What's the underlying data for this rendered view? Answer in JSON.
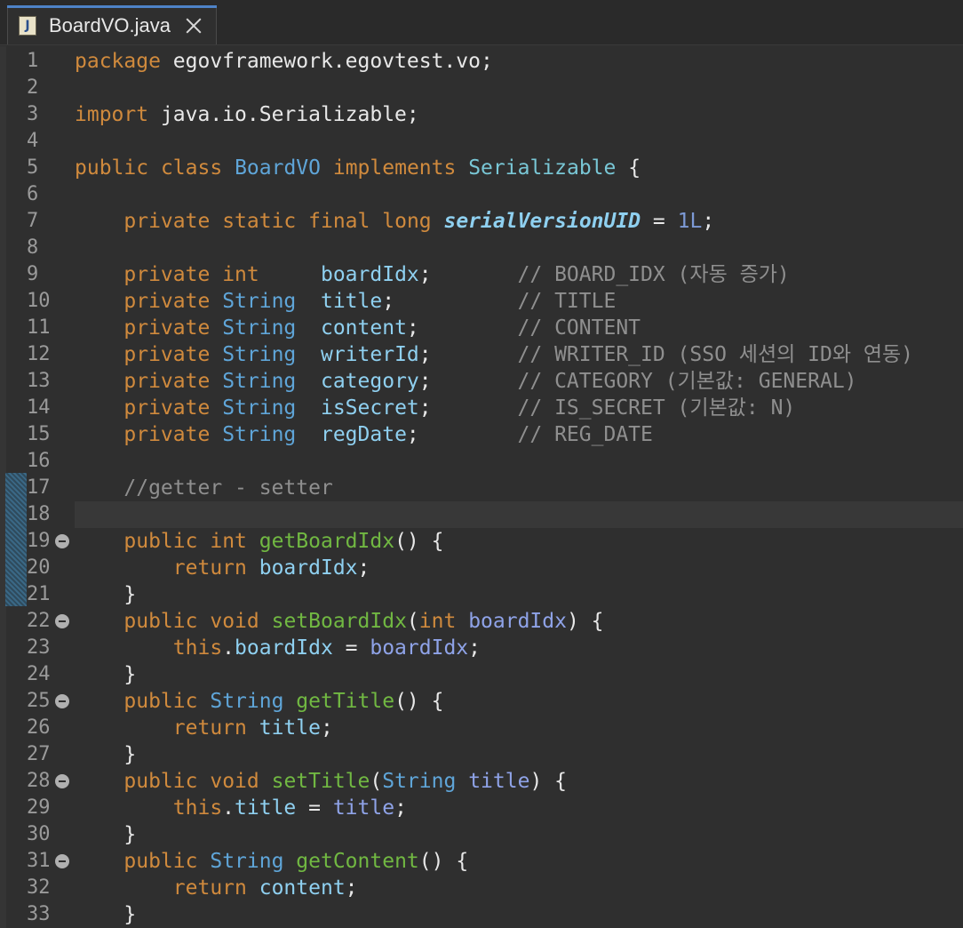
{
  "tab": {
    "title": "BoardVO.java",
    "icon_letter": "J"
  },
  "lines": [
    [
      [
        "kw",
        "package"
      ],
      [
        "txt",
        " egovframework.egovtest.vo;"
      ]
    ],
    [],
    [
      [
        "kw",
        "import"
      ],
      [
        "txt",
        " java.io.Serializable;"
      ]
    ],
    [],
    [
      [
        "kw",
        "public"
      ],
      [
        "txt",
        " "
      ],
      [
        "kw",
        "class"
      ],
      [
        "txt",
        " "
      ],
      [
        "type",
        "BoardVO"
      ],
      [
        "txt",
        " "
      ],
      [
        "kw",
        "implements"
      ],
      [
        "txt",
        " "
      ],
      [
        "cls",
        "Serializable"
      ],
      [
        "txt",
        " {"
      ]
    ],
    [],
    [
      [
        "txt",
        "    "
      ],
      [
        "kw",
        "private"
      ],
      [
        "txt",
        " "
      ],
      [
        "kw",
        "static"
      ],
      [
        "txt",
        " "
      ],
      [
        "kw",
        "final"
      ],
      [
        "txt",
        " "
      ],
      [
        "kw",
        "long"
      ],
      [
        "txt",
        " "
      ],
      [
        "sfld",
        "serialVersionUID"
      ],
      [
        "txt",
        " = "
      ],
      [
        "num",
        "1L"
      ],
      [
        "txt",
        ";"
      ]
    ],
    [],
    [
      [
        "txt",
        "    "
      ],
      [
        "kw",
        "private"
      ],
      [
        "txt",
        " "
      ],
      [
        "kw",
        "int"
      ],
      [
        "txt",
        "     "
      ],
      [
        "fld",
        "boardIdx"
      ],
      [
        "txt",
        ";       "
      ],
      [
        "cmt",
        "// BOARD_IDX (자동 증가)"
      ]
    ],
    [
      [
        "txt",
        "    "
      ],
      [
        "kw",
        "private"
      ],
      [
        "txt",
        " "
      ],
      [
        "type",
        "String"
      ],
      [
        "txt",
        "  "
      ],
      [
        "fld",
        "title"
      ],
      [
        "txt",
        ";          "
      ],
      [
        "cmt",
        "// TITLE"
      ]
    ],
    [
      [
        "txt",
        "    "
      ],
      [
        "kw",
        "private"
      ],
      [
        "txt",
        " "
      ],
      [
        "type",
        "String"
      ],
      [
        "txt",
        "  "
      ],
      [
        "fld",
        "content"
      ],
      [
        "txt",
        ";        "
      ],
      [
        "cmt",
        "// CONTENT"
      ]
    ],
    [
      [
        "txt",
        "    "
      ],
      [
        "kw",
        "private"
      ],
      [
        "txt",
        " "
      ],
      [
        "type",
        "String"
      ],
      [
        "txt",
        "  "
      ],
      [
        "fld",
        "writerId"
      ],
      [
        "txt",
        ";       "
      ],
      [
        "cmt",
        "// WRITER_ID (SSO 세션의 ID와 연동)"
      ]
    ],
    [
      [
        "txt",
        "    "
      ],
      [
        "kw",
        "private"
      ],
      [
        "txt",
        " "
      ],
      [
        "type",
        "String"
      ],
      [
        "txt",
        "  "
      ],
      [
        "fld",
        "category"
      ],
      [
        "txt",
        ";       "
      ],
      [
        "cmt",
        "// CATEGORY (기본값: GENERAL)"
      ]
    ],
    [
      [
        "txt",
        "    "
      ],
      [
        "kw",
        "private"
      ],
      [
        "txt",
        " "
      ],
      [
        "type",
        "String"
      ],
      [
        "txt",
        "  "
      ],
      [
        "fld",
        "isSecret"
      ],
      [
        "txt",
        ";       "
      ],
      [
        "cmt",
        "// IS_SECRET (기본값: N)"
      ]
    ],
    [
      [
        "txt",
        "    "
      ],
      [
        "kw",
        "private"
      ],
      [
        "txt",
        " "
      ],
      [
        "type",
        "String"
      ],
      [
        "txt",
        "  "
      ],
      [
        "fld",
        "regDate"
      ],
      [
        "txt",
        ";        "
      ],
      [
        "cmt",
        "// REG_DATE"
      ]
    ],
    [],
    [
      [
        "txt",
        "    "
      ],
      [
        "cmt",
        "//getter - setter"
      ]
    ],
    [],
    [
      [
        "txt",
        "    "
      ],
      [
        "kw",
        "public"
      ],
      [
        "txt",
        " "
      ],
      [
        "kw",
        "int"
      ],
      [
        "txt",
        " "
      ],
      [
        "mth",
        "getBoardIdx"
      ],
      [
        "txt",
        "() {"
      ]
    ],
    [
      [
        "txt",
        "        "
      ],
      [
        "kw",
        "return"
      ],
      [
        "txt",
        " "
      ],
      [
        "fld",
        "boardIdx"
      ],
      [
        "txt",
        ";"
      ]
    ],
    [
      [
        "txt",
        "    }"
      ]
    ],
    [
      [
        "txt",
        "    "
      ],
      [
        "kw",
        "public"
      ],
      [
        "txt",
        " "
      ],
      [
        "kw",
        "void"
      ],
      [
        "txt",
        " "
      ],
      [
        "mth",
        "setBoardIdx"
      ],
      [
        "txt",
        "("
      ],
      [
        "kw",
        "int"
      ],
      [
        "txt",
        " "
      ],
      [
        "prm",
        "boardIdx"
      ],
      [
        "txt",
        ") {"
      ]
    ],
    [
      [
        "txt",
        "        "
      ],
      [
        "kw",
        "this"
      ],
      [
        "txt",
        "."
      ],
      [
        "fld",
        "boardIdx"
      ],
      [
        "txt",
        " = "
      ],
      [
        "prm",
        "boardIdx"
      ],
      [
        "txt",
        ";"
      ]
    ],
    [
      [
        "txt",
        "    }"
      ]
    ],
    [
      [
        "txt",
        "    "
      ],
      [
        "kw",
        "public"
      ],
      [
        "txt",
        " "
      ],
      [
        "type",
        "String"
      ],
      [
        "txt",
        " "
      ],
      [
        "mth",
        "getTitle"
      ],
      [
        "txt",
        "() {"
      ]
    ],
    [
      [
        "txt",
        "        "
      ],
      [
        "kw",
        "return"
      ],
      [
        "txt",
        " "
      ],
      [
        "fld",
        "title"
      ],
      [
        "txt",
        ";"
      ]
    ],
    [
      [
        "txt",
        "    }"
      ]
    ],
    [
      [
        "txt",
        "    "
      ],
      [
        "kw",
        "public"
      ],
      [
        "txt",
        " "
      ],
      [
        "kw",
        "void"
      ],
      [
        "txt",
        " "
      ],
      [
        "mth",
        "setTitle"
      ],
      [
        "txt",
        "("
      ],
      [
        "type",
        "String"
      ],
      [
        "txt",
        " "
      ],
      [
        "prm",
        "title"
      ],
      [
        "txt",
        ") {"
      ]
    ],
    [
      [
        "txt",
        "        "
      ],
      [
        "kw",
        "this"
      ],
      [
        "txt",
        "."
      ],
      [
        "fld",
        "title"
      ],
      [
        "txt",
        " = "
      ],
      [
        "prm",
        "title"
      ],
      [
        "txt",
        ";"
      ]
    ],
    [
      [
        "txt",
        "    }"
      ]
    ],
    [
      [
        "txt",
        "    "
      ],
      [
        "kw",
        "public"
      ],
      [
        "txt",
        " "
      ],
      [
        "type",
        "String"
      ],
      [
        "txt",
        " "
      ],
      [
        "mth",
        "getContent"
      ],
      [
        "txt",
        "() {"
      ]
    ],
    [
      [
        "txt",
        "        "
      ],
      [
        "kw",
        "return"
      ],
      [
        "txt",
        " "
      ],
      [
        "fld",
        "content"
      ],
      [
        "txt",
        ";"
      ]
    ],
    [
      [
        "txt",
        "    }"
      ]
    ]
  ],
  "line_numbers": [
    "1",
    "2",
    "3",
    "4",
    "5",
    "6",
    "7",
    "8",
    "9",
    "10",
    "11",
    "12",
    "13",
    "14",
    "15",
    "16",
    "17",
    "18",
    "19",
    "20",
    "21",
    "22",
    "23",
    "24",
    "25",
    "26",
    "27",
    "28",
    "29",
    "30",
    "31",
    "32",
    "33"
  ],
  "fold_lines": [
    19,
    22,
    25,
    28,
    31
  ],
  "current_line": 18
}
